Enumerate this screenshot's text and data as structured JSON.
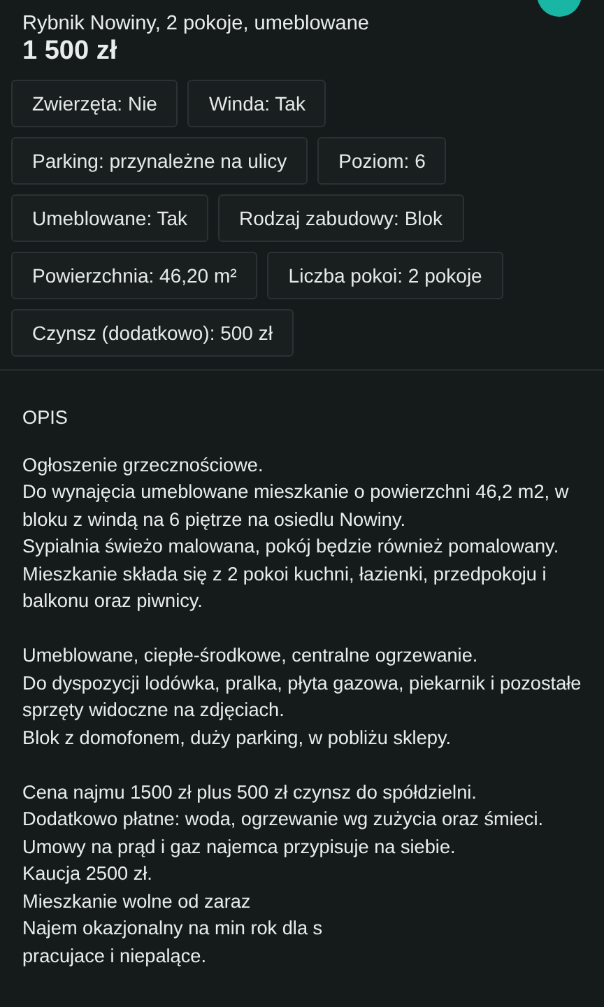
{
  "listing": {
    "title": "Rybnik Nowiny, 2 pokoje, umeblowane",
    "price": "1 500 zł"
  },
  "attributes": [
    {
      "label": "Zwierzęta: Nie"
    },
    {
      "label": "Winda: Tak"
    },
    {
      "label": "Parking: przynależne na ulicy"
    },
    {
      "label": "Poziom: 6"
    },
    {
      "label": "Umeblowane: Tak"
    },
    {
      "label": "Rodzaj zabudowy: Blok"
    },
    {
      "label": "Powierzchnia: 46,20 m²"
    },
    {
      "label": "Liczba pokoi: 2 pokoje"
    },
    {
      "label": "Czynsz (dodatkowo): 500 zł"
    }
  ],
  "description": {
    "heading": "OPIS",
    "paragraphs": [
      [
        "Ogłoszenie grzecznościowe.",
        "Do wynajęcia umeblowane mieszkanie o powierzchni 46,2 m2, w bloku z windą na 6 piętrze na osiedlu Nowiny.",
        "Sypialnia świeżo malowana, pokój będzie również pomalowany.",
        "Mieszkanie składa się z 2 pokoi kuchni, łazienki, przedpokoju i balkonu oraz piwnicy."
      ],
      [
        "Umeblowane, ciepłe-środkowe, centralne ogrzewanie.",
        "Do dyspozycji lodówka, pralka, płyta gazowa, piekarnik i pozostałe sprzęty widoczne na zdjęciach.",
        "Blok z domofonem, duży parking, w pobliżu sklepy."
      ],
      [
        "Cena najmu 1500 zł plus 500 zł czynsz do spółdzielni.",
        "Dodatkowo płatne: woda, ogrzewanie wg zużycia oraz śmieci.",
        "Umowy na prąd i gaz najemca przypisuje na siebie.",
        "Kaucja 2500 zł.",
        "Mieszkanie wolne od zaraz",
        "Najem okazjonalny na min rok dla s",
        "pracujace i niepalące."
      ]
    ]
  }
}
